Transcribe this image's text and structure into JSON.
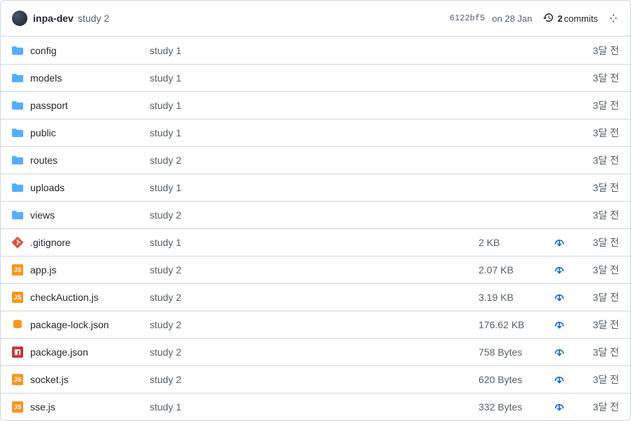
{
  "header": {
    "author": "inpa-dev",
    "commit_message": "study 2",
    "hash": "6122bf5",
    "date": "on 28 Jan",
    "commits_count": "2",
    "commits_label": "commits"
  },
  "rows": [
    {
      "icon": "folder",
      "name": "config",
      "msg": "study 1",
      "size": "",
      "dl": false,
      "time": "3달 전"
    },
    {
      "icon": "folder",
      "name": "models",
      "msg": "study 1",
      "size": "",
      "dl": false,
      "time": "3달 전"
    },
    {
      "icon": "folder",
      "name": "passport",
      "msg": "study 1",
      "size": "",
      "dl": false,
      "time": "3달 전"
    },
    {
      "icon": "folder",
      "name": "public",
      "msg": "study 1",
      "size": "",
      "dl": false,
      "time": "3달 전"
    },
    {
      "icon": "folder",
      "name": "routes",
      "msg": "study 2",
      "size": "",
      "dl": false,
      "time": "3달 전"
    },
    {
      "icon": "folder",
      "name": "uploads",
      "msg": "study 1",
      "size": "",
      "dl": false,
      "time": "3달 전"
    },
    {
      "icon": "folder",
      "name": "views",
      "msg": "study 2",
      "size": "",
      "dl": false,
      "time": "3달 전"
    },
    {
      "icon": "git",
      "name": ".gitignore",
      "msg": "study 1",
      "size": "2 KB",
      "dl": true,
      "time": "3달 전"
    },
    {
      "icon": "js",
      "name": "app.js",
      "msg": "study 2",
      "size": "2.07 KB",
      "dl": true,
      "time": "3달 전"
    },
    {
      "icon": "js",
      "name": "checkAuction.js",
      "msg": "study 2",
      "size": "3.19 KB",
      "dl": true,
      "time": "3달 전"
    },
    {
      "icon": "db",
      "name": "package-lock.json",
      "msg": "study 2",
      "size": "176.62 KB",
      "dl": true,
      "time": "3달 전"
    },
    {
      "icon": "npm",
      "name": "package.json",
      "msg": "study 2",
      "size": "758 Bytes",
      "dl": true,
      "time": "3달 전"
    },
    {
      "icon": "js",
      "name": "socket.js",
      "msg": "study 2",
      "size": "620 Bytes",
      "dl": true,
      "time": "3달 전"
    },
    {
      "icon": "js",
      "name": "sse.js",
      "msg": "study 1",
      "size": "332 Bytes",
      "dl": true,
      "time": "3달 전"
    }
  ]
}
